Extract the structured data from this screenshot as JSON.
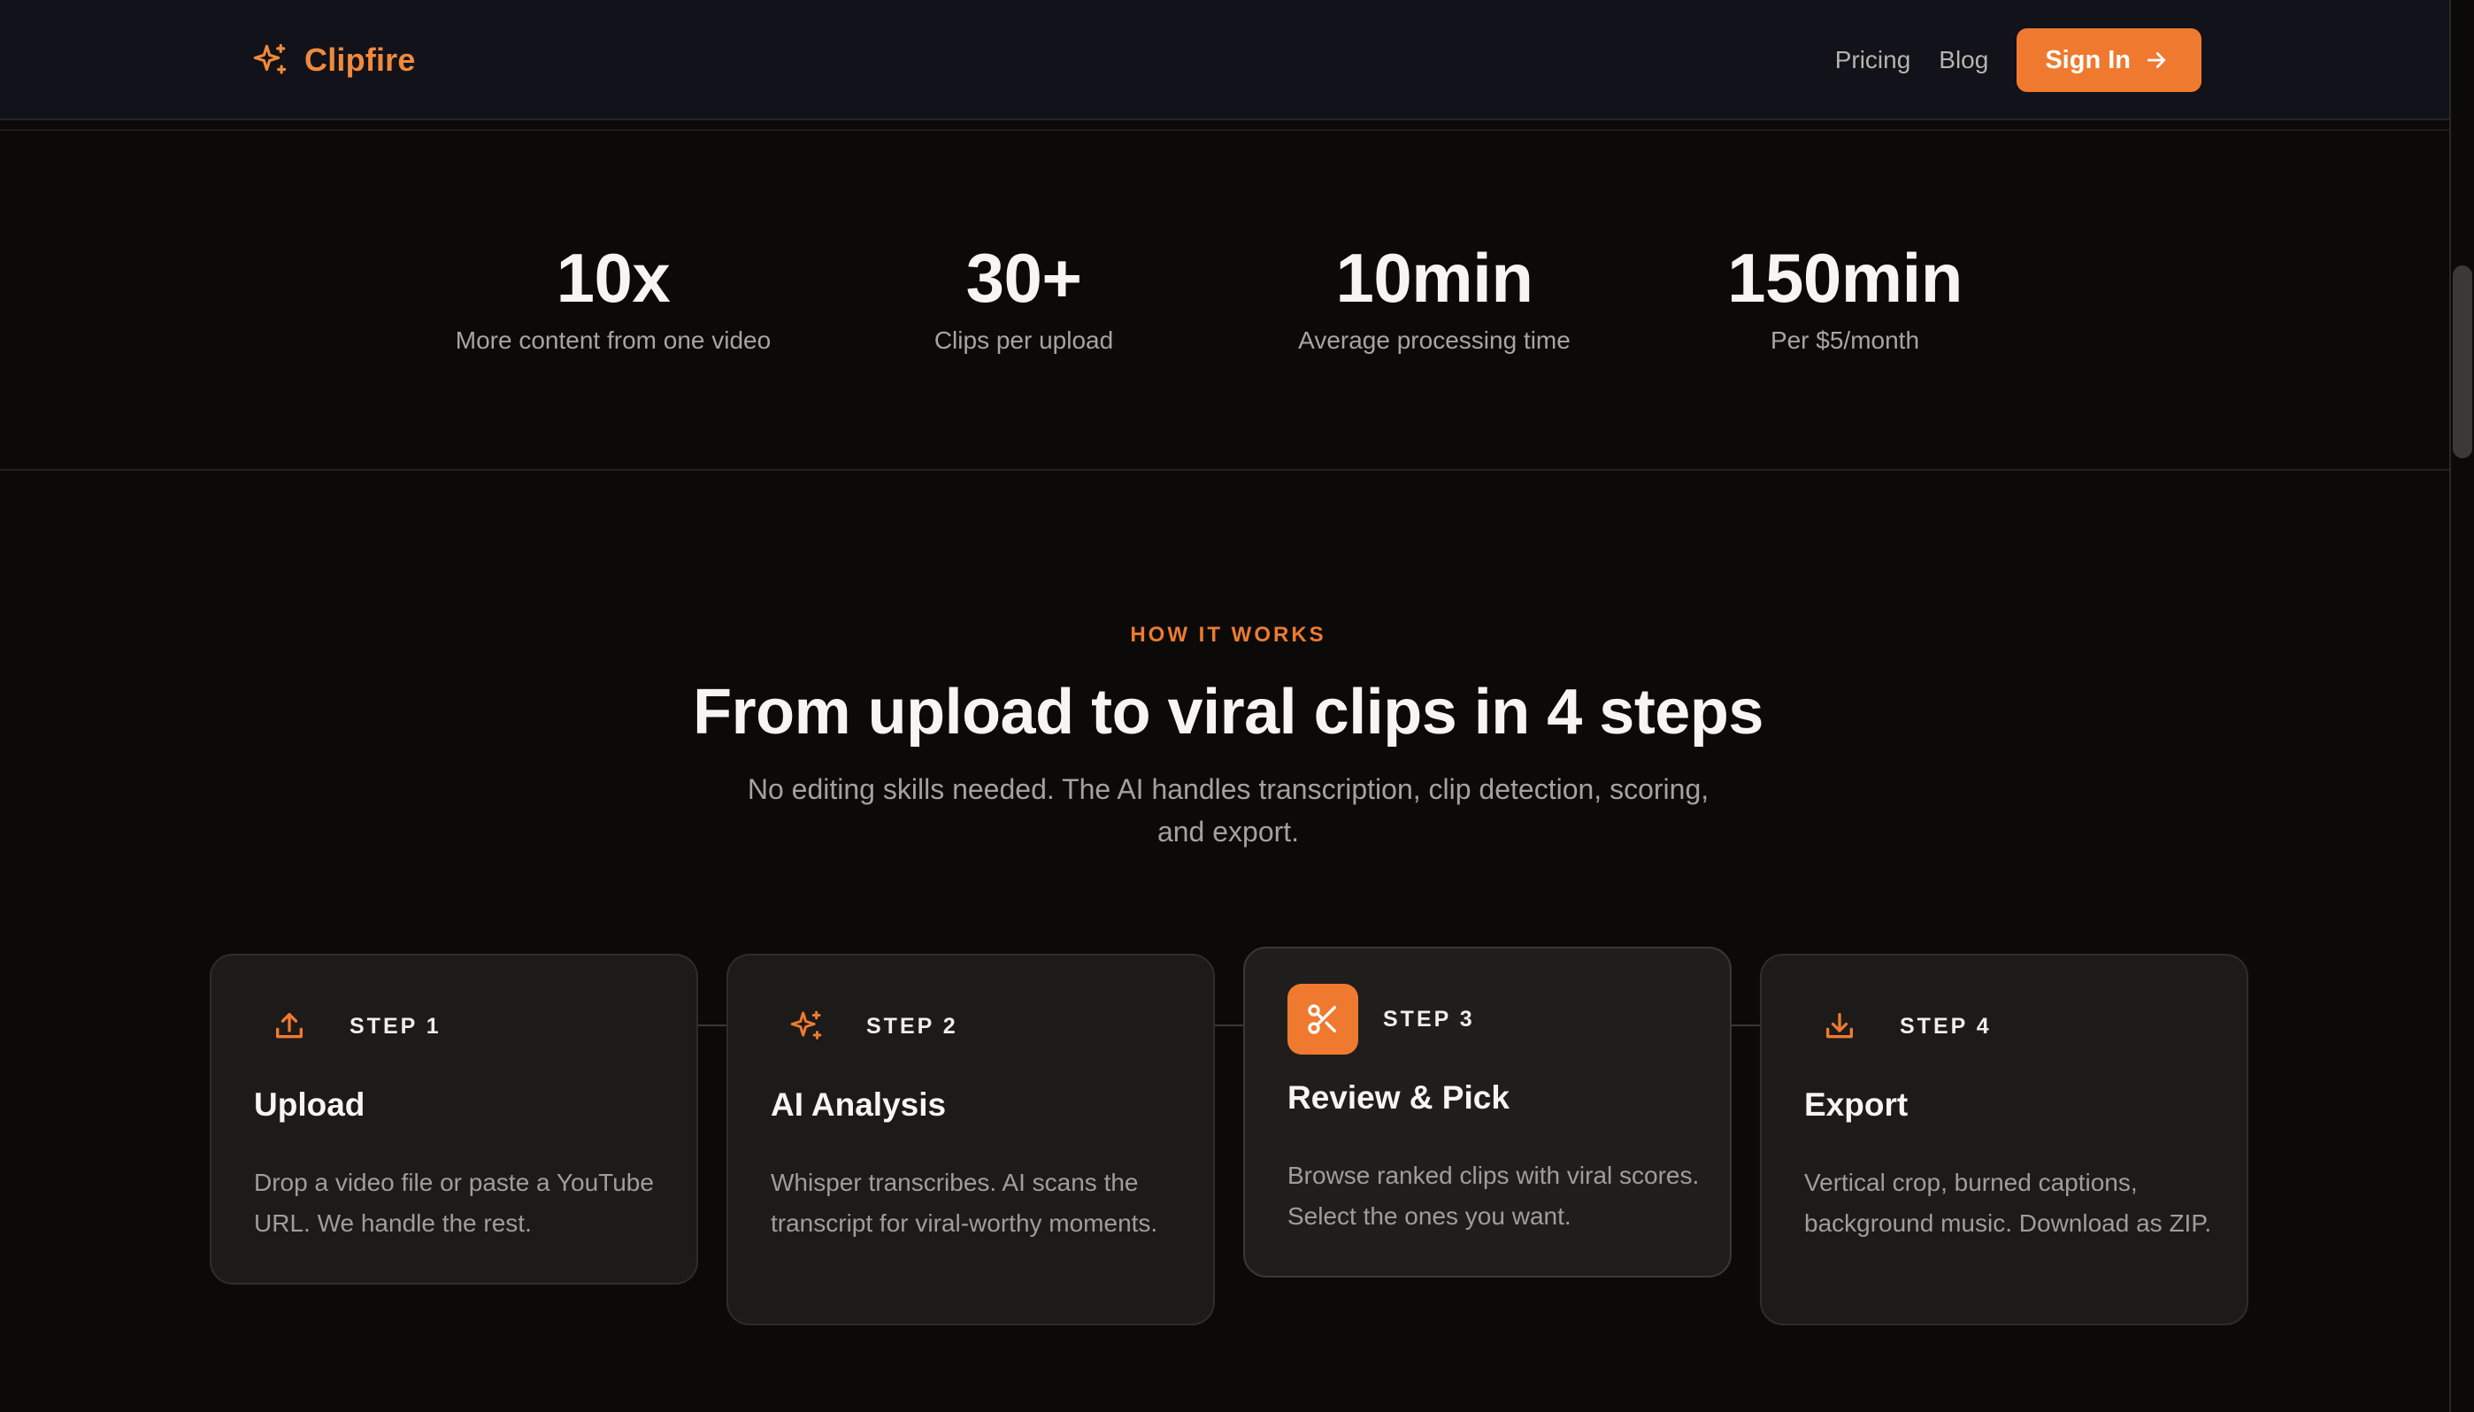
{
  "nav": {
    "brand_name": "Clipfire",
    "brand_icon": "sparkles-icon",
    "links": [
      "Pricing",
      "Blog"
    ],
    "cta_label": "Sign In",
    "cta_icon": "arrow-right-icon"
  },
  "stats": [
    {
      "value": "10x",
      "label": "More content from one video"
    },
    {
      "value": "30+",
      "label": "Clips per upload"
    },
    {
      "value": "10min",
      "label": "Average processing time"
    },
    {
      "value": "150min",
      "label": "Per $5/month"
    }
  ],
  "how": {
    "eyebrow": "HOW IT WORKS",
    "title": "From upload to viral clips in 4 steps",
    "subtitle": "No editing skills needed. The AI handles transcription, clip detection, scoring, and export."
  },
  "steps": [
    {
      "step": "STEP 1",
      "title": "Upload",
      "desc": "Drop a video file or paste a YouTube URL. We handle the rest.",
      "icon": "upload-icon"
    },
    {
      "step": "STEP 2",
      "title": "AI Analysis",
      "desc": "Whisper transcribes. AI scans the transcript for viral-worthy moments.",
      "icon": "sparkles-icon"
    },
    {
      "step": "STEP 3",
      "title": "Review & Pick",
      "desc": "Browse ranked clips with viral scores. Select the ones you want.",
      "icon": "scissors-icon",
      "active": true
    },
    {
      "step": "STEP 4",
      "title": "Export",
      "desc": "Vertical crop, burned captions, background music. Download as ZIP.",
      "icon": "download-icon"
    }
  ],
  "colors": {
    "accent": "#ef7a2f",
    "background": "#0b0a09",
    "nav_background": "#11121a",
    "card_background": "#1c1b1a"
  }
}
